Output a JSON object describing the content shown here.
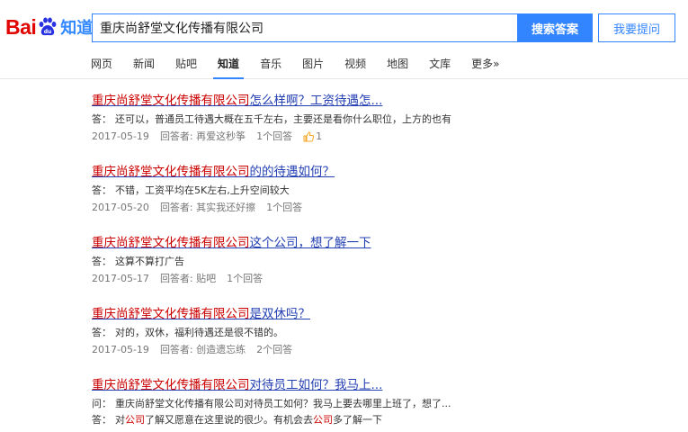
{
  "logo": {
    "bai": "Bai",
    "du": "du",
    "zhidao": "知道"
  },
  "search": {
    "value": "重庆尚舒堂文化传播有限公司",
    "submit_label": "搜索答案",
    "ask_label": "我要提问"
  },
  "nav": [
    {
      "label": "网页",
      "active": false
    },
    {
      "label": "新闻",
      "active": false
    },
    {
      "label": "贴吧",
      "active": false
    },
    {
      "label": "知道",
      "active": true
    },
    {
      "label": "音乐",
      "active": false
    },
    {
      "label": "图片",
      "active": false
    },
    {
      "label": "视频",
      "active": false
    },
    {
      "label": "地图",
      "active": false
    },
    {
      "label": "文库",
      "active": false
    },
    {
      "label": "更多»",
      "active": false
    }
  ],
  "results": [
    {
      "title_hl": "重庆尚舒堂文化传播有限公司",
      "title_rest": "怎么样啊？工资待遇怎...",
      "lines": [
        {
          "label": "答：",
          "text": "还可以，普通员工待遇大概在五千左右，主要还是看你什么职位，上方的也有"
        }
      ],
      "date": "2017-05-19",
      "answerer": "回答者: 再爱这秒筝",
      "count": "1个回答",
      "likes": "1"
    },
    {
      "title_hl": "重庆尚舒堂文化传播有限公司",
      "title_rest": "的的待遇如何？",
      "lines": [
        {
          "label": "答：",
          "text": "不错，工资平均在5K左右,上升空间较大"
        }
      ],
      "date": "2017-05-20",
      "answerer": "回答者: 其实我还好擦",
      "count": "1个回答"
    },
    {
      "title_hl": "重庆尚舒堂文化传播有限公司",
      "title_rest": "这个公司，想了解一下",
      "lines": [
        {
          "label": "答：",
          "text": "这算不算打广告"
        }
      ],
      "date": "2017-05-17",
      "answerer": "回答者: 贴吧",
      "count": "1个回答"
    },
    {
      "title_hl": "重庆尚舒堂文化传播有限公司",
      "title_rest": "是双休吗？",
      "lines": [
        {
          "label": "答：",
          "text": "对的，双休，福利待遇还是很不错的。"
        }
      ],
      "date": "2017-05-19",
      "answerer": "回答者: 创造遗忘练",
      "count": "2个回答"
    },
    {
      "title_hl": "重庆尚舒堂文化传播有限公司",
      "title_rest": "对待员工如何？我马上...",
      "lines": [
        {
          "label": "问：",
          "text": "重庆尚舒堂文化传播有限公司对待员工如何？我马上要去哪里上班了，想了..."
        },
        {
          "label": "答：",
          "pre": "对",
          "hl1": "公司",
          "mid": "了解又愿意在这里说的很少。有机会去",
          "hl2": "公司",
          "post": "多了解一下"
        }
      ]
    }
  ]
}
